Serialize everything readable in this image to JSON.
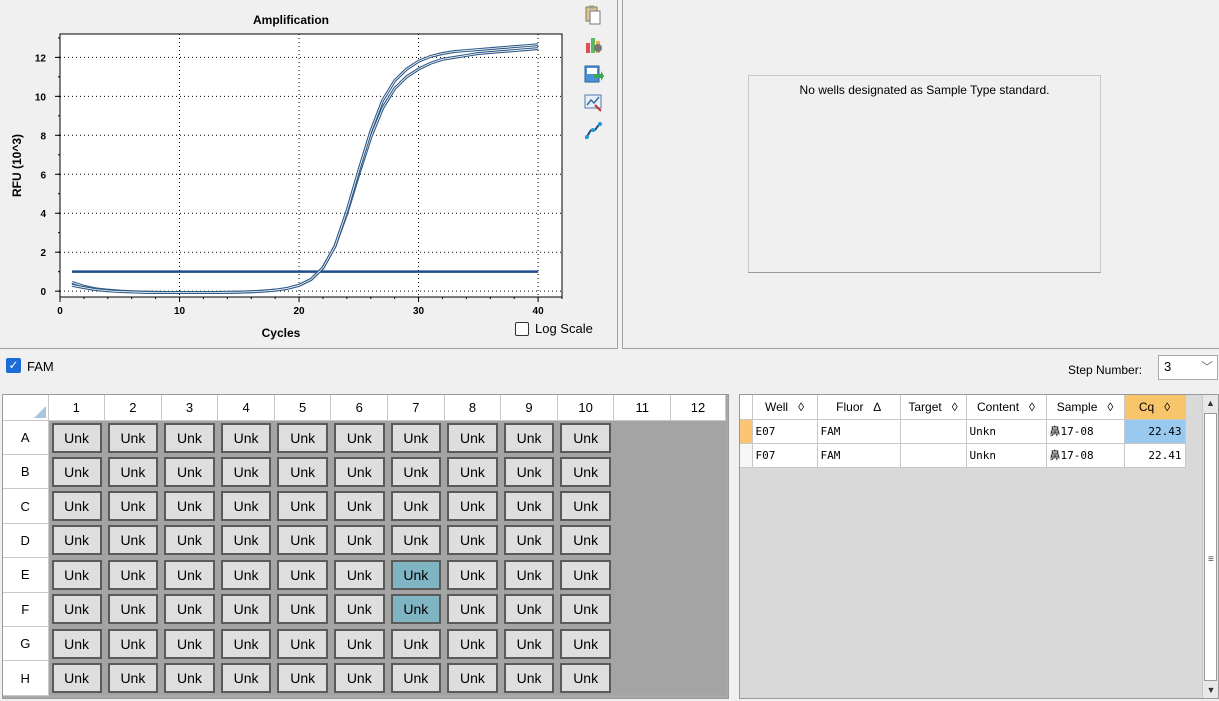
{
  "chart": {
    "title": "Amplification",
    "xlabel": "Cycles",
    "ylabel": "RFU (10^3)",
    "log_scale_label": "Log Scale",
    "log_scale_checked": false
  },
  "chart_data": {
    "type": "line",
    "title": "Amplification",
    "xlabel": "Cycles",
    "ylabel": "RFU (10^3)",
    "xlim": [
      0,
      42
    ],
    "ylim": [
      -0.3,
      13.2
    ],
    "x_ticks": [
      0,
      10,
      20,
      30,
      40
    ],
    "y_ticks": [
      0,
      2,
      4,
      6,
      8,
      10,
      12
    ],
    "grid": "dotted",
    "threshold": 1.0,
    "series": [
      {
        "well": "E07",
        "x": [
          1,
          2,
          3,
          4,
          5,
          6,
          7,
          8,
          9,
          10,
          11,
          12,
          13,
          14,
          15,
          16,
          17,
          18,
          19,
          20,
          21,
          22,
          23,
          24,
          25,
          26,
          27,
          28,
          29,
          30,
          31,
          32,
          33,
          34,
          35,
          36,
          37,
          38,
          39,
          40
        ],
        "values": [
          0.45,
          0.25,
          0.12,
          0.05,
          0.0,
          -0.03,
          -0.05,
          -0.06,
          -0.07,
          -0.07,
          -0.07,
          -0.07,
          -0.07,
          -0.06,
          -0.05,
          -0.03,
          0.0,
          0.05,
          0.14,
          0.3,
          0.6,
          1.2,
          2.3,
          4.0,
          6.0,
          7.9,
          9.4,
          10.4,
          11.0,
          11.4,
          11.7,
          11.9,
          12.0,
          12.1,
          12.2,
          12.25,
          12.3,
          12.35,
          12.4,
          12.45
        ]
      },
      {
        "well": "F07",
        "x": [
          1,
          2,
          3,
          4,
          5,
          6,
          7,
          8,
          9,
          10,
          11,
          12,
          13,
          14,
          15,
          16,
          17,
          18,
          19,
          20,
          21,
          22,
          23,
          24,
          25,
          26,
          27,
          28,
          29,
          30,
          31,
          32,
          33,
          34,
          35,
          36,
          37,
          38,
          39,
          40
        ],
        "values": [
          0.3,
          0.18,
          0.08,
          0.02,
          -0.02,
          -0.04,
          -0.06,
          -0.07,
          -0.07,
          -0.07,
          -0.07,
          -0.07,
          -0.07,
          -0.06,
          -0.05,
          -0.03,
          0.0,
          0.05,
          0.14,
          0.3,
          0.6,
          1.2,
          2.3,
          4.1,
          6.2,
          8.2,
          9.8,
          10.8,
          11.4,
          11.8,
          12.05,
          12.2,
          12.3,
          12.35,
          12.4,
          12.45,
          12.5,
          12.55,
          12.6,
          12.65
        ]
      }
    ]
  },
  "toolbar_icons": [
    "copy-icon",
    "chart-options-icon",
    "export-icon",
    "zoom-chart-icon",
    "curve-fit-icon"
  ],
  "standard_curve": {
    "message": "No wells designated as Sample Type standard."
  },
  "fluor_bar": {
    "fam_label": "FAM",
    "fam_checked": true,
    "step_label": "Step Number:",
    "step_value": "3"
  },
  "plate": {
    "columns": [
      "1",
      "2",
      "3",
      "4",
      "5",
      "6",
      "7",
      "8",
      "9",
      "10",
      "11",
      "12"
    ],
    "rows": [
      "A",
      "B",
      "C",
      "D",
      "E",
      "F",
      "G",
      "H"
    ],
    "well_label": "Unk",
    "filled_columns": 10,
    "selected_wells": [
      "E7",
      "F7"
    ]
  },
  "results": {
    "headers": [
      "Well",
      "Fluor",
      "Target",
      "Content",
      "Sample",
      "Cq"
    ],
    "sort_marks": [
      "◊",
      "∆",
      "◊",
      "◊",
      "◊",
      "◊"
    ],
    "rows": [
      {
        "well": "E07",
        "fluor": "FAM",
        "target": "",
        "content": "Unkn",
        "sample": "鼻17-08",
        "cq": "22.43"
      },
      {
        "well": "F07",
        "fluor": "FAM",
        "target": "",
        "content": "Unkn",
        "sample": "鼻17-08",
        "cq": "22.41"
      }
    ]
  },
  "colors": {
    "curve": "#3a6a9c",
    "threshold": "#1f4e8c",
    "selected_well": "#7fb5c3",
    "cq_header": "#f9c56b",
    "cq_selected": "#99c9ee"
  }
}
